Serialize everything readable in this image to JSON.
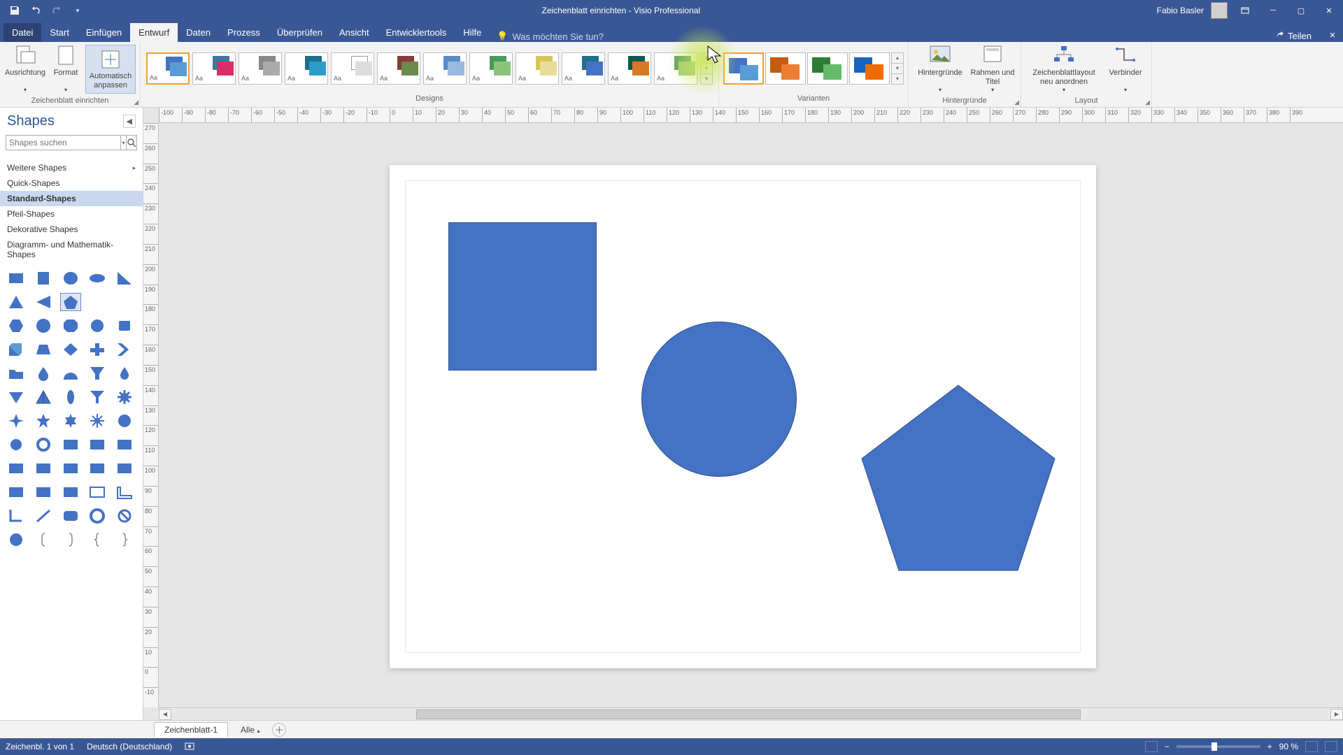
{
  "title": {
    "doc": "Zeichenblatt einrichten",
    "sep": " - ",
    "app": "Visio Professional"
  },
  "user": {
    "name": "Fabio Basler"
  },
  "share_label": "Teilen",
  "tabs": {
    "file": "Datei",
    "start": "Start",
    "insert": "Einfügen",
    "design": "Entwurf",
    "data": "Daten",
    "process": "Prozess",
    "review": "Überprüfen",
    "view": "Ansicht",
    "devtools": "Entwicklertools",
    "help": "Hilfe"
  },
  "tell_me_placeholder": "Was möchten Sie tun?",
  "ribbon": {
    "group_setup": "Zeichenblatt einrichten",
    "btn_orientation": "Ausrichtung",
    "btn_format": "Format",
    "btn_autofit": "Automatisch anpassen",
    "group_designs": "Designs",
    "group_variants": "Varianten",
    "group_backgrounds": "Hintergründe",
    "btn_backgrounds": "Hintergründe",
    "btn_borders": "Rahmen und Titel",
    "group_layout": "Layout",
    "btn_relayout": "Zeichenblattlayout neu anordnen",
    "btn_connector": "Verbinder",
    "theme_tag": "Aa"
  },
  "shapes_panel": {
    "title": "Shapes",
    "search_placeholder": "Shapes suchen",
    "more": "Weitere Shapes",
    "quick": "Quick-Shapes",
    "standard": "Standard-Shapes",
    "arrow": "Pfeil-Shapes",
    "decorative": "Dekorative Shapes",
    "math": "Diagramm- und Mathematik-Shapes"
  },
  "ruler_h": [
    "-100",
    "-90",
    "-80",
    "-70",
    "-60",
    "-50",
    "-40",
    "-30",
    "-20",
    "-10",
    "0",
    "10",
    "20",
    "30",
    "40",
    "50",
    "60",
    "70",
    "80",
    "90",
    "100",
    "110",
    "120",
    "130",
    "140",
    "150",
    "160",
    "170",
    "180",
    "190",
    "200",
    "210",
    "220",
    "230",
    "240",
    "250",
    "260",
    "270",
    "280",
    "290",
    "300",
    "310",
    "320",
    "330",
    "340",
    "350",
    "360",
    "370",
    "380",
    "390"
  ],
  "ruler_v": [
    "270",
    "260",
    "250",
    "240",
    "230",
    "220",
    "210",
    "200",
    "190",
    "180",
    "170",
    "160",
    "150",
    "140",
    "130",
    "120",
    "110",
    "100",
    "90",
    "80",
    "70",
    "60",
    "50",
    "40",
    "30",
    "20",
    "10",
    "0",
    "-10"
  ],
  "page_tab": "Zeichenblatt-1",
  "all_tab": "Alle",
  "status": {
    "page_count": "Zeichenbl. 1 von 1",
    "lang": "Deutsch (Deutschland)",
    "zoom": "90 %"
  }
}
